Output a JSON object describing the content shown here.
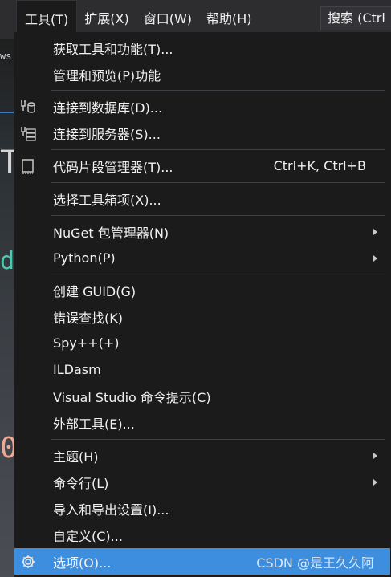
{
  "menubar": {
    "items": [
      "工具(T)",
      "扩展(X)",
      "窗口(W)",
      "帮助(H)"
    ],
    "search": "搜索 (Ctrl"
  },
  "background": {
    "frag_ws": "ws",
    "frag_T": "T",
    "frag_d": "d",
    "frag_0": "0"
  },
  "menu": {
    "items": [
      {
        "label": "获取工具和功能(T)..."
      },
      {
        "label": "管理和预览(P)功能"
      },
      {
        "label": "连接到数据库(D)...",
        "icon": "database-connect-icon"
      },
      {
        "label": "连接到服务器(S)...",
        "icon": "server-connect-icon"
      },
      {
        "label": "代码片段管理器(T)...",
        "icon": "snippet-manager-icon",
        "shortcut": "Ctrl+K, Ctrl+B"
      },
      {
        "label": "选择工具箱项(X)..."
      },
      {
        "label": "NuGet 包管理器(N)",
        "submenu": true
      },
      {
        "label": "Python(P)",
        "submenu": true
      },
      {
        "label": "创建 GUID(G)"
      },
      {
        "label": "错误查找(K)"
      },
      {
        "label": "Spy++(+)"
      },
      {
        "label": "ILDasm"
      },
      {
        "label": "Visual Studio 命令提示(C)"
      },
      {
        "label": "外部工具(E)..."
      },
      {
        "label": "主题(H)",
        "submenu": true
      },
      {
        "label": "命令行(L)",
        "submenu": true
      },
      {
        "label": "导入和导出设置(I)..."
      },
      {
        "label": "自定义(C)..."
      },
      {
        "label": "选项(O)...",
        "icon": "gear-icon",
        "highlighted": true
      }
    ],
    "watermark": "CSDN @是王久久阿"
  },
  "colors": {
    "menu_bg": "#1b1b1c",
    "bar_bg": "#2d2d30",
    "highlight": "#3e8ee0",
    "text": "#f1f1f1"
  }
}
